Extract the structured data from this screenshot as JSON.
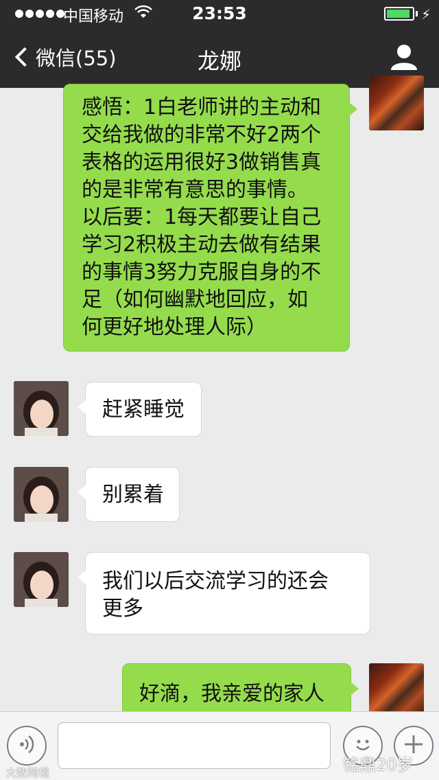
{
  "status_bar": {
    "carrier": "中国移动",
    "time": "23:53",
    "battery_level": 0.92
  },
  "nav": {
    "back_label": "微信(55)",
    "title": "龙娜"
  },
  "messages": [
    {
      "direction": "out",
      "lines": [
        "感悟：1白老师讲的主动和",
        "交给我做的非常不好2两个",
        "表格的运用很好3做销售真",
        "的是非常有意思的事情。",
        "以后要：1每天都要让自己",
        "学习2积极主动去做有结果",
        "的事情3努力克服自身的不",
        "足（如何幽默地回应，如",
        "何更好地处理人际）"
      ]
    },
    {
      "direction": "in",
      "lines": [
        "赶紧睡觉"
      ]
    },
    {
      "direction": "in",
      "lines": [
        "别累着"
      ]
    },
    {
      "direction": "in",
      "lines": [
        "我们以后交流学习的还会",
        "更多"
      ]
    },
    {
      "direction": "out",
      "lines": [
        "好滴，我亲爱的家人"
      ]
    }
  ],
  "input": {
    "value": "",
    "placeholder": ""
  },
  "icons": {
    "voice": "voice-icon",
    "emoji": "emoji-icon",
    "more": "plus-icon",
    "contact": "contact-icon"
  },
  "watermarks": {
    "left": "大数跨境",
    "right": "铭鼎20岁"
  },
  "colors": {
    "nav_bg": "#2b2b2d",
    "outgoing_bubble": "#95dc4d",
    "incoming_bubble": "#ffffff",
    "chat_bg": "#ebebeb",
    "battery": "#4cd964"
  }
}
